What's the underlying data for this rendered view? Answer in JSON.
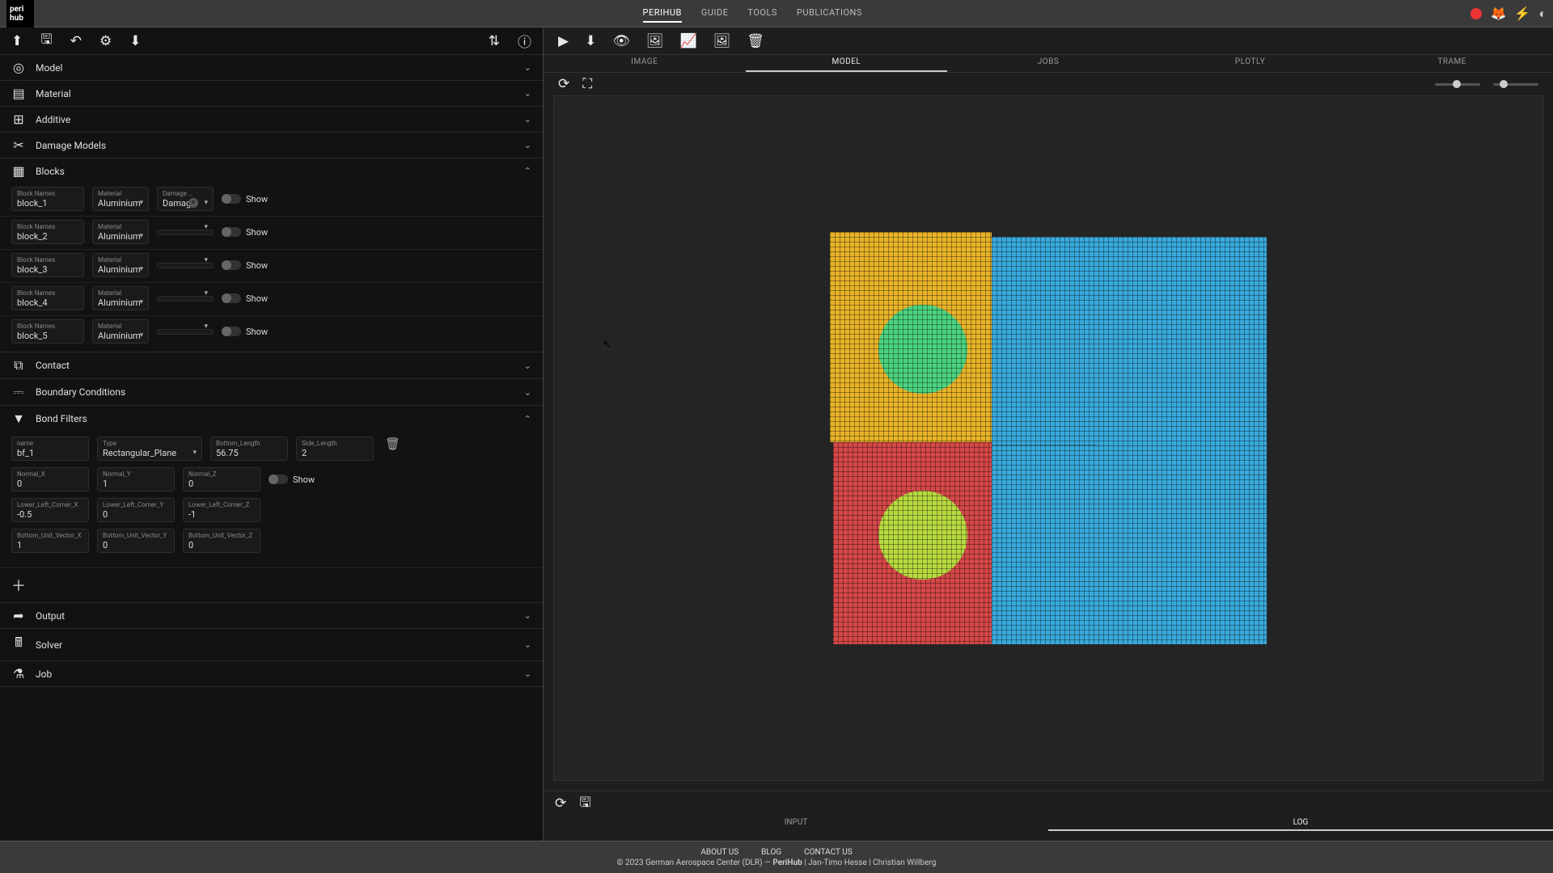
{
  "logo": {
    "line1": "peri",
    "line2": "hub"
  },
  "nav": {
    "items": [
      "PERIHUB",
      "GUIDE",
      "TOOLS",
      "PUBLICATIONS"
    ],
    "activeIndex": 0
  },
  "left": {
    "sections": {
      "model": "Model",
      "material": "Material",
      "additive": "Additive",
      "damage": "Damage Models",
      "blocks": "Blocks",
      "contact": "Contact",
      "boundary": "Boundary Conditions",
      "bond": "Bond Filters",
      "output": "Output",
      "solver": "Solver",
      "job": "Job"
    },
    "labels": {
      "blockNames": "Block Names",
      "material": "Material",
      "damage": "Damage …",
      "show": "Show",
      "name": "name",
      "type": "Type",
      "bottomLength": "Bottom_Length",
      "sideLength": "Side_Length",
      "normalX": "Normal_X",
      "normalY": "Normal_Y",
      "normalZ": "Normal_Z",
      "llcX": "Lower_Left_Corner_X",
      "llcY": "Lower_Left_Corner_Y",
      "llcZ": "Lower_Left_Corner_Z",
      "buvX": "Bottom_Unit_Vector_X",
      "buvY": "Bottom_Unit_Vector_Y",
      "buvZ": "Bottom_Unit_Vector_Z"
    },
    "blocks": [
      {
        "name": "block_1",
        "material": "Aluminium",
        "damage": "Damage"
      },
      {
        "name": "block_2",
        "material": "Aluminium",
        "damage": ""
      },
      {
        "name": "block_3",
        "material": "Aluminium",
        "damage": ""
      },
      {
        "name": "block_4",
        "material": "Aluminium",
        "damage": ""
      },
      {
        "name": "block_5",
        "material": "Aluminium",
        "damage": ""
      }
    ],
    "bondFilter": {
      "name": "bf_1",
      "type": "Rectangular_Plane",
      "bottomLength": "56.75",
      "sideLength": "2",
      "normalX": "0",
      "normalY": "1",
      "normalZ": "0",
      "llcX": "-0.5",
      "llcY": "0",
      "llcZ": "-1",
      "buvX": "1",
      "buvY": "0",
      "buvZ": "0"
    }
  },
  "right": {
    "tabs": [
      "IMAGE",
      "MODEL",
      "JOBS",
      "PLOTLY",
      "TRAME"
    ],
    "activeTab": 1,
    "bottomTabs": [
      "INPUT",
      "LOG"
    ],
    "bottomActive": 1
  },
  "footer": {
    "links": [
      "ABOUT US",
      "BLOG",
      "CONTACT US"
    ],
    "copyright_prefix": "© 2023 German Aerospace Center (DLR) — ",
    "copyright_brand": "PeriHub",
    "copyright_suffix": " | Jan-Timo Hesse | Christian Willberg"
  },
  "mesh": {
    "colors": {
      "yellow": "#e8b328",
      "blue": "#39a9db",
      "red": "#d54848",
      "green": "#4bd27f",
      "lime": "#b8d940"
    }
  }
}
